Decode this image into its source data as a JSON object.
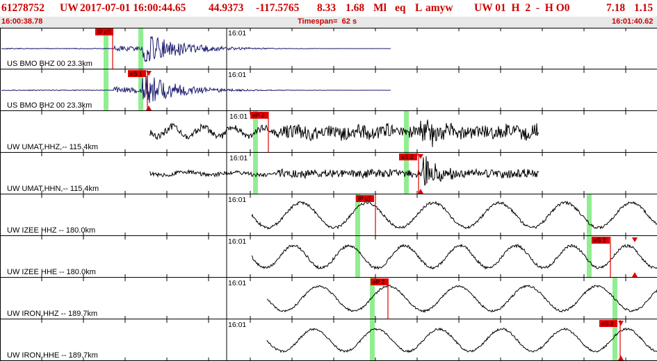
{
  "header": {
    "event_id": "61278752",
    "network": "UW",
    "origin_time": "2017-07-01 16:00:44.65",
    "latitude": "44.9373",
    "longitude": "-117.5765",
    "depth": "8.33",
    "magnitude": "1.68",
    "magnitude_type": "Ml",
    "event_type": "eq",
    "flag": "L",
    "author": "amyw",
    "solution_info": "UW 01  H  2  -  H O0",
    "value_a": "7.18",
    "value_b": "1.15"
  },
  "timebar": {
    "start": "16:00:38.78",
    "span": "Timespan=  62 s",
    "end": "16:01:40.62"
  },
  "colors": {
    "header_text": "#cc0000",
    "trace": "#000000",
    "trace_bmo": "#1a1a6e",
    "pick_box": "#e00000",
    "green_band": "#90ee90",
    "timebar_bg": "#e8e8e8"
  },
  "traces": [
    {
      "label": "US BMO BHZ 00 23.3km",
      "minute_tick": "16:01",
      "picks": [
        {
          "label": "iP c0",
          "kind": "P"
        }
      ]
    },
    {
      "label": "US BMO BH2 00 23.3km",
      "minute_tick": "16:01",
      "picks": [
        {
          "label": "eS 1",
          "kind": "S"
        }
      ]
    },
    {
      "label": "UW UMAT,HHZ,-- 115.4km",
      "minute_tick": "16:01",
      "picks": [
        {
          "label": "eP 2",
          "kind": "P"
        }
      ]
    },
    {
      "label": "UW UMAT,HHN,-- 115.4km",
      "minute_tick": "16:01",
      "picks": [
        {
          "label": "eS 2",
          "kind": "S"
        }
      ]
    },
    {
      "label": "UW IZEE HHZ -- 180.0km",
      "minute_tick": "16:01",
      "picks": [
        {
          "label": "iP c1",
          "kind": "P"
        }
      ]
    },
    {
      "label": "UW IZEE HHE -- 180.0km",
      "minute_tick": "16:01",
      "picks": [
        {
          "label": "eS 2",
          "kind": "S"
        }
      ]
    },
    {
      "label": "UW IRON,HHZ -- 189.7km",
      "minute_tick": "16:01",
      "picks": [
        {
          "label": "eP 2",
          "kind": "P"
        }
      ]
    },
    {
      "label": "UW IRON,HHE -- 189.7km",
      "minute_tick": "16:01",
      "picks": [
        {
          "label": "eS 2",
          "kind": "S"
        }
      ]
    }
  ]
}
